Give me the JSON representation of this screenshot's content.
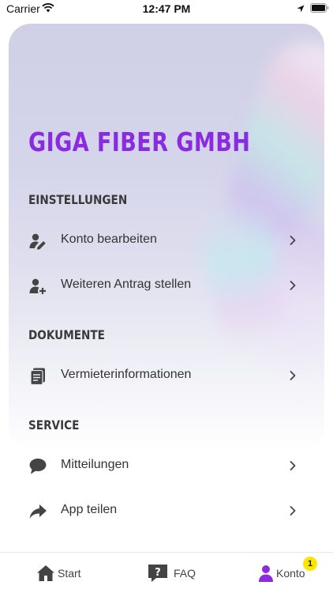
{
  "status_bar": {
    "carrier": "Carrier",
    "time": "12:47 PM"
  },
  "header": {
    "company_name": "GIGA FIBER GMBH"
  },
  "sections": [
    {
      "title": "EINSTELLUNGEN",
      "items": [
        {
          "label": "Konto bearbeiten",
          "icon": "user-edit-icon"
        },
        {
          "label": "Weiteren Antrag stellen",
          "icon": "user-add-icon"
        }
      ]
    },
    {
      "title": "DOKUMENTE",
      "items": [
        {
          "label": "Vermieterinformationen",
          "icon": "document-icon"
        }
      ]
    },
    {
      "title": "SERVICE",
      "items": [
        {
          "label": "Mitteilungen",
          "icon": "chat-bubble-icon"
        },
        {
          "label": "App teilen",
          "icon": "share-icon"
        }
      ]
    }
  ],
  "tab_bar": {
    "tabs": [
      {
        "label": "Start",
        "icon": "home-icon"
      },
      {
        "label": "FAQ",
        "icon": "question-icon"
      },
      {
        "label": "Konto",
        "icon": "person-icon",
        "badge": "1"
      }
    ]
  },
  "colors": {
    "brand": "#8a2be2",
    "icon": "#444444",
    "badge": "#ffe600"
  }
}
